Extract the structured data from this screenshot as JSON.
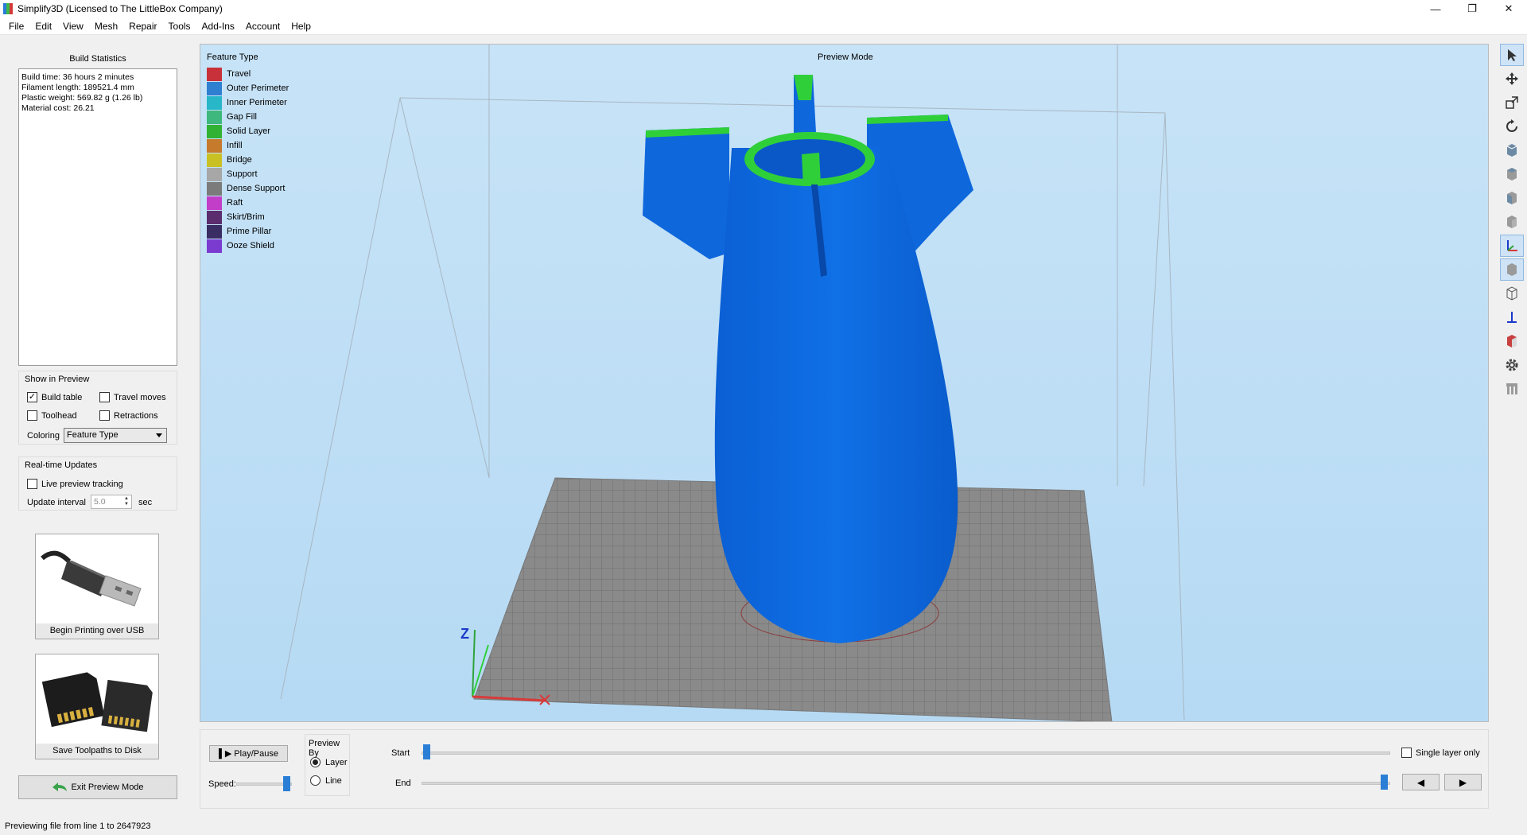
{
  "window": {
    "title": "Simplify3D (Licensed to The LittleBox Company)",
    "minimize": "—",
    "restore": "❐",
    "close": "✕"
  },
  "menu": [
    "File",
    "Edit",
    "View",
    "Mesh",
    "Repair",
    "Tools",
    "Add-Ins",
    "Account",
    "Help"
  ],
  "build_statistics": {
    "title": "Build Statistics",
    "lines": [
      "Build time: 36 hours 2 minutes",
      "Filament length: 189521.4 mm",
      "Plastic weight: 569.82 g (1.26 lb)",
      "Material cost: 26.21"
    ]
  },
  "show_in_preview": {
    "title": "Show in Preview",
    "build_table": {
      "label": "Build table",
      "checked": true
    },
    "travel_moves": {
      "label": "Travel moves",
      "checked": false
    },
    "toolhead": {
      "label": "Toolhead",
      "checked": false
    },
    "retractions": {
      "label": "Retractions",
      "checked": false
    },
    "coloring_label": "Coloring",
    "coloring_value": "Feature Type"
  },
  "realtime": {
    "title": "Real-time Updates",
    "live_tracking": {
      "label": "Live preview tracking",
      "checked": false
    },
    "interval_label": "Update interval",
    "interval_value": "5.0",
    "interval_unit": "sec"
  },
  "actions": {
    "usb_label": "Begin Printing over USB",
    "sd_label": "Save Toolpaths to Disk",
    "exit_label": "Exit Preview Mode"
  },
  "viewport": {
    "legend_title": "Feature Type",
    "mode_title": "Preview Mode",
    "axis_label": "Z",
    "legend": [
      {
        "label": "Travel",
        "color": "#c8313a"
      },
      {
        "label": "Outer Perimeter",
        "color": "#2f80d0"
      },
      {
        "label": "Inner Perimeter",
        "color": "#28b6c9"
      },
      {
        "label": "Gap Fill",
        "color": "#3fb87d"
      },
      {
        "label": "Solid Layer",
        "color": "#32b234"
      },
      {
        "label": "Infill",
        "color": "#c57a2c"
      },
      {
        "label": "Bridge",
        "color": "#c9c124"
      },
      {
        "label": "Support",
        "color": "#a7a7a7"
      },
      {
        "label": "Dense Support",
        "color": "#7b7b7b"
      },
      {
        "label": "Raft",
        "color": "#c23ec8"
      },
      {
        "label": "Skirt/Brim",
        "color": "#5b2d6e"
      },
      {
        "label": "Prime Pillar",
        "color": "#3a2d63"
      },
      {
        "label": "Ooze Shield",
        "color": "#7b3bd0"
      }
    ],
    "model_color": "#0a62d8",
    "top_color": "#2fcf3a"
  },
  "controls": {
    "play_label": "Play/Pause",
    "speed_label": "Speed:",
    "preview_by_label": "Preview By",
    "layer_label": "Layer",
    "line_label": "Line",
    "preview_by_selected": "Layer",
    "start_label": "Start",
    "end_label": "End",
    "single_layer": {
      "label": "Single layer only",
      "checked": false
    }
  },
  "status": "Previewing file from line 1 to 2647923"
}
